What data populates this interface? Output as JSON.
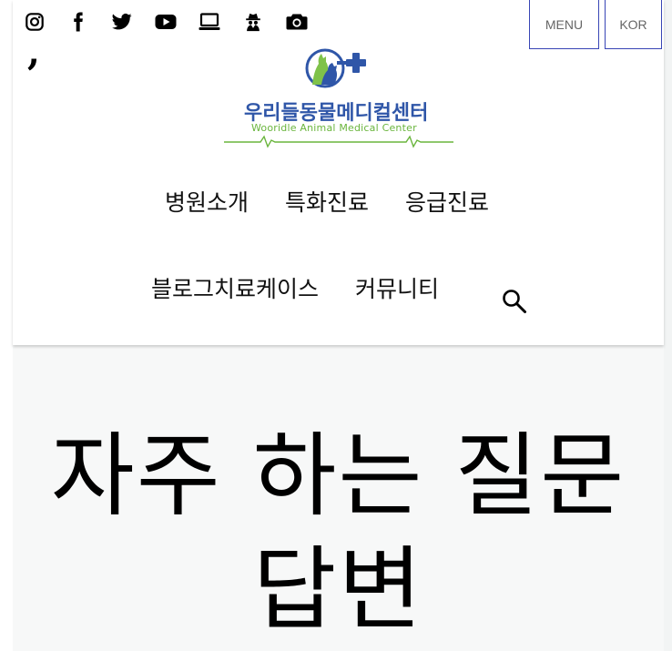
{
  "social": [
    {
      "name": "instagram-icon"
    },
    {
      "name": "facebook-icon"
    },
    {
      "name": "twitter-icon"
    },
    {
      "name": "youtube-icon"
    },
    {
      "name": "laptop-icon"
    },
    {
      "name": "spy-icon"
    },
    {
      "name": "camera-icon"
    }
  ],
  "top_buttons": {
    "menu": "MENU",
    "language": "KOR"
  },
  "logo": {
    "title": "우리들동물메디컬센터",
    "subtitle": "Wooridle Animal Medical Center"
  },
  "nav": {
    "row1": [
      "병원소개",
      "특화진료",
      "응급진료"
    ],
    "row2": [
      "블로그치료케이스",
      "커뮤니티"
    ]
  },
  "page": {
    "title_line1": "자주 하는 질문",
    "title_line2": "답변"
  },
  "colors": {
    "brand_blue": "#2f56a8",
    "brand_green": "#6ab53d",
    "button_border": "#3845b5",
    "background": "#f7f8f8"
  }
}
